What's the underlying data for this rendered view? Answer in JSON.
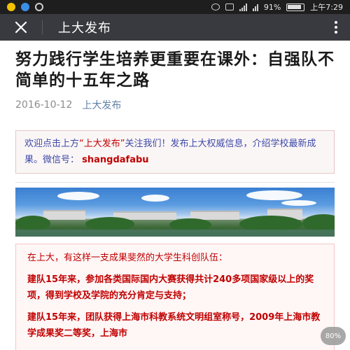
{
  "status_bar": {
    "battery": "91%",
    "time": "上午7:29"
  },
  "app_bar": {
    "title": "上大发布",
    "close_icon": "close-icon",
    "more_icon": "more-vertical-icon"
  },
  "article": {
    "title": "努力践行学生培养更重要在课外：自强队不简单的十五年之路",
    "date": "2016-10-12",
    "account": "上大发布",
    "notice": {
      "part1": "欢迎点击上方",
      "account_quoted": "“上大发布”",
      "part2": "关注我们！发布上大权威信息，介绍学校最新成果。微信号：",
      "wechat_id": "shangdafabu"
    },
    "paragraphs": [
      "在上大，有这样一支成果斐然的大学生科创队伍：",
      "建队15年来，参加各类国际国内大赛获得共计240多项国家级以上的奖项，得到学校及学院的充分肯定与支持；",
      "建队15年来，团队获得上海市科教系统文明组室称号，2009年上海市教学成果奖二等奖，上海市"
    ]
  },
  "floating_badge": "80%"
}
